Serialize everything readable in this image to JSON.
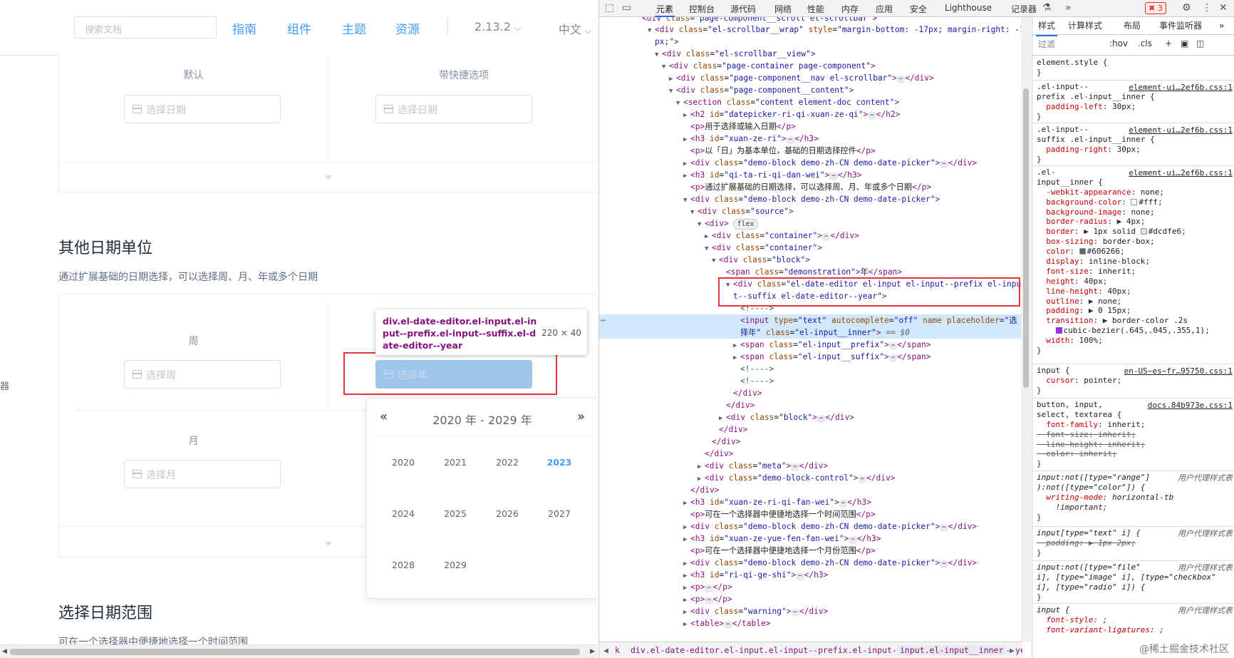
{
  "nav": {
    "search_placeholder": "搜索文档",
    "links": [
      "指南",
      "组件",
      "主题",
      "资源"
    ],
    "version": "2.13.2",
    "lang": "中文"
  },
  "demo1": {
    "col_left": "默认",
    "col_right": "带快捷选项",
    "input_left": "选择日期",
    "input_right": "选择日期"
  },
  "section1": {
    "title": "其他日期单位",
    "desc": "通过扩展基础的日期选择，可以选择周、月、年或多个日期"
  },
  "demo2": {
    "week_label": "周",
    "week_input": "选择周",
    "year_input": "选择年",
    "month_label": "月",
    "month_input": "选择月"
  },
  "side_fragment": "器",
  "tooltip": {
    "selector": "div.el-date-editor.el-input.el-input--prefix.el-input--suffix.el-date-editor--year",
    "dims": "220 × 40"
  },
  "picker": {
    "title": "2020 年 - 2029 年",
    "prev": "«",
    "next": "»",
    "years": [
      "2020",
      "2021",
      "2022",
      "2023",
      "2024",
      "2025",
      "2026",
      "2027",
      "2028",
      "2029"
    ],
    "current": "2023"
  },
  "section2": {
    "title": "选择日期范围",
    "desc": "可在一个选择器中便捷地选择一个时间范围"
  },
  "devtools": {
    "tabs": [
      "元素",
      "控制台",
      "源代码",
      "网络",
      "性能",
      "内存",
      "应用",
      "安全",
      "Lighthouse",
      "记录器"
    ],
    "errors": "3",
    "breadcrumbs": [
      "k",
      "div.el-date-editor.el-input.el-input--prefix.el-input--suffix.el-date-editor--year",
      "input.el-input__inner"
    ],
    "styles_tabs": [
      "样式",
      "计算样式",
      "布局",
      "事件监听器"
    ],
    "filter_placeholder": "过滤",
    "filter_opts": [
      ":hov",
      ".cls",
      "+"
    ],
    "watermark": "@稀土掘金技术社区"
  }
}
